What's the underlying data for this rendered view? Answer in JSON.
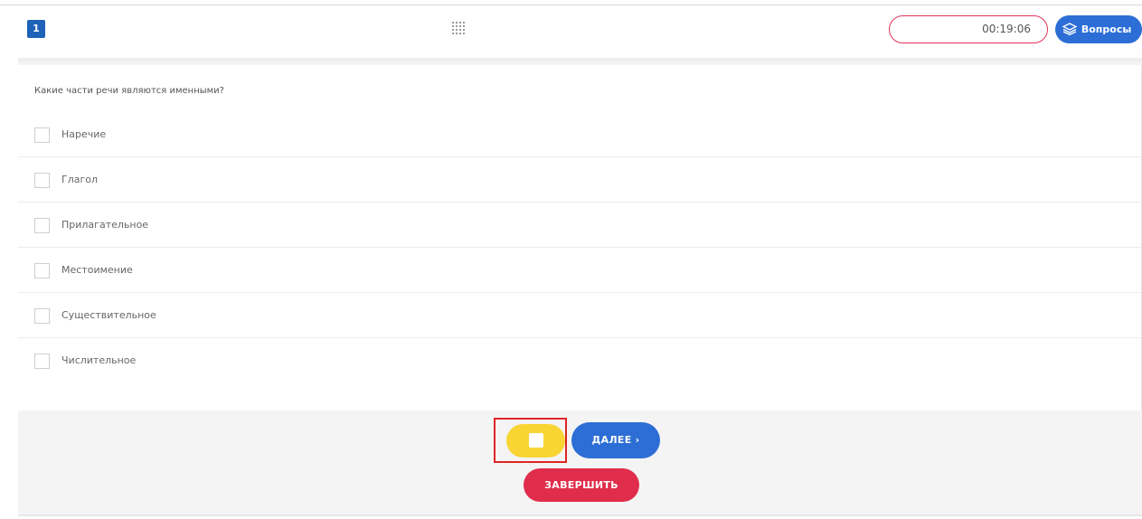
{
  "header": {
    "question_number": "1",
    "timer": "00:19:06",
    "questions_label": "Вопросы",
    "questions_icon": "layers-icon",
    "center_icon": "grid-dots-icon"
  },
  "question": {
    "text": "Какие части речи являются именными?",
    "options": [
      {
        "label": "Наречие",
        "checked": false
      },
      {
        "label": "Глагол",
        "checked": false
      },
      {
        "label": "Прилагательное",
        "checked": false
      },
      {
        "label": "Местоимение",
        "checked": false
      },
      {
        "label": "Существительное",
        "checked": false
      },
      {
        "label": "Числительное",
        "checked": false
      }
    ]
  },
  "footer": {
    "next_label": "ДАЛЕЕ ›",
    "finish_label": "ЗАВЕРШИТЬ"
  },
  "colors": {
    "accent_blue": "#2c6ed5",
    "finish_red": "#e02d4b",
    "yellow": "#f8d533",
    "timer_border": "#e2335a"
  }
}
